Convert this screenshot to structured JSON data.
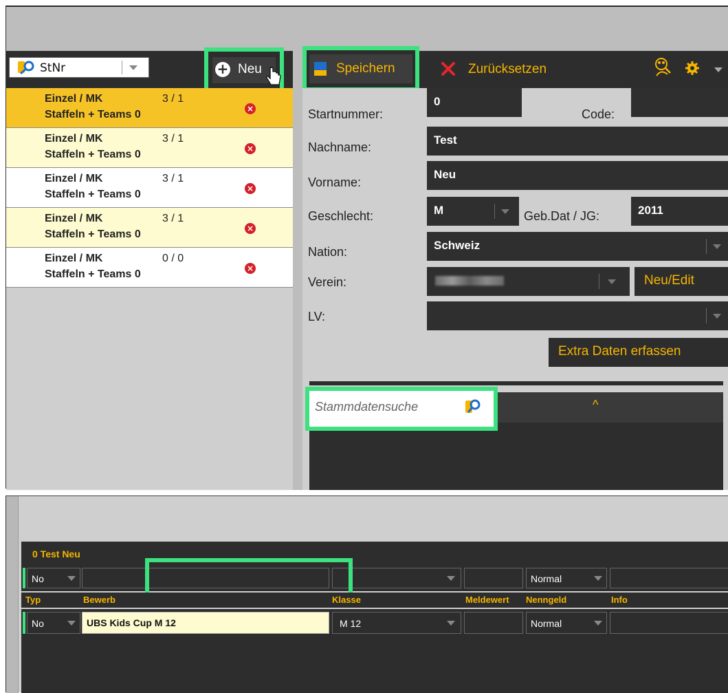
{
  "list_toolbar": {
    "search_value": "StNr",
    "new_label": "Neu"
  },
  "entries": [
    {
      "line1": "Einzel / MK",
      "count": "3 / 1",
      "line2": "Staffeln + Teams 0",
      "bg": "#f6c327"
    },
    {
      "line1": "Einzel / MK",
      "count": "3 / 1",
      "line2": "Staffeln + Teams 0",
      "bg": "#fefbd0"
    },
    {
      "line1": "Einzel / MK",
      "count": "3 / 1",
      "line2": "Staffeln + Teams 0",
      "bg": "#ffffff"
    },
    {
      "line1": "Einzel / MK",
      "count": "3 / 1",
      "line2": "Staffeln + Teams 0",
      "bg": "#fefbd0"
    },
    {
      "line1": "Einzel / MK",
      "count": "0 / 0",
      "line2": "Staffeln + Teams 0",
      "bg": "#ffffff"
    }
  ],
  "form_toolbar": {
    "save_label": "Speichern",
    "reset_label": "Zurücksetzen"
  },
  "form": {
    "startnummer_label": "Startnummer:",
    "startnummer_value": "0",
    "code_label": "Code:",
    "code_value": "",
    "nachname_label": "Nachname:",
    "nachname_value": "Test",
    "vorname_label": "Vorname:",
    "vorname_value": "Neu",
    "geschlecht_label": "Geschlecht:",
    "geschlecht_value": "M",
    "gebdat_label": "Geb.Dat / JG:",
    "gebdat_value": "2011",
    "nation_label": "Nation:",
    "nation_value": "Schweiz",
    "verein_label": "Verein:",
    "verein_edit_label": "Neu/Edit",
    "lv_label": "LV:",
    "lv_value": "",
    "extra_label": "Extra Daten erfassen",
    "stamm_placeholder": "Stammdatensuche",
    "collapse_label": "^"
  },
  "entry_panel": {
    "title": "0 Test Neu",
    "filter": {
      "typ": "No",
      "nenngeld": "Normal"
    },
    "headers": [
      "Typ",
      "Bewerb",
      "Klasse",
      "Meldewert",
      "Nenngeld",
      "Info"
    ],
    "rows": [
      {
        "typ": "No",
        "bewerb": "UBS Kids Cup M 12",
        "klasse": "M 12",
        "meldewert": "",
        "nenngeld": "Normal",
        "info": ""
      }
    ]
  },
  "colors": {
    "highlight": "#3ee17f",
    "accent": "#f6b500",
    "dark": "#2d2d2d",
    "error": "#d4202a"
  }
}
